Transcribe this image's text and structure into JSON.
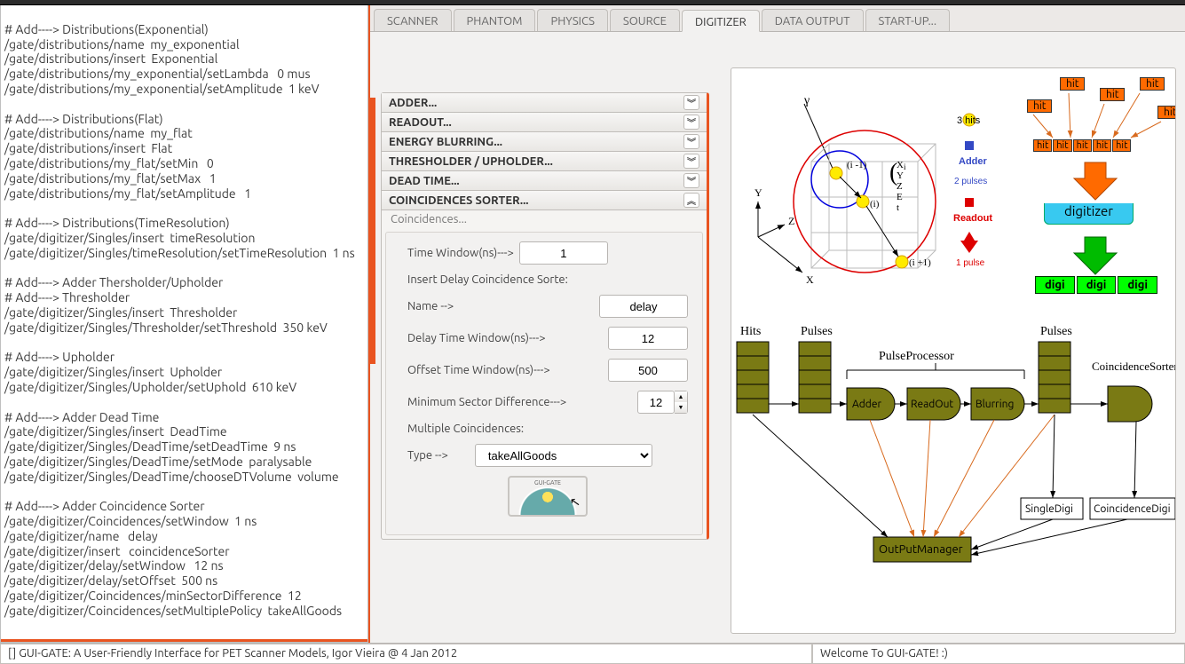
{
  "tabs": [
    "SCANNER",
    "PHANTOM",
    "PHYSICS",
    "SOURCE",
    "DIGITIZER",
    "DATA OUTPUT",
    "START-UP..."
  ],
  "active_tab": "DIGITIZER",
  "code_lines": [
    "",
    "# Add----> Distributions(Exponential)",
    "/gate/distributions/name  my_exponential",
    "/gate/distributions/insert  Exponential",
    "/gate/distributions/my_exponential/setLambda   0 mus",
    "/gate/distributions/my_exponential/setAmplitude  1 keV",
    "",
    "# Add----> Distributions(Flat)",
    "/gate/distributions/name  my_flat",
    "/gate/distributions/insert  Flat",
    "/gate/distributions/my_flat/setMin   0",
    "/gate/distributions/my_flat/setMax   1",
    "/gate/distributions/my_flat/setAmplitude   1",
    "",
    "# Add----> Distributions(TimeResolution)",
    "/gate/digitizer/Singles/insert  timeResolution",
    "/gate/digitizer/Singles/timeResolution/setTimeResolution  1 ns",
    "",
    "# Add----> Adder Thersholder/Upholder",
    "# Add----> Thresholder",
    "/gate/digitizer/Singles/insert  Thresholder",
    "/gate/digitizer/Singles/Thresholder/setThreshold  350 keV",
    "",
    "# Add----> Upholder",
    "/gate/digitizer/Singles/insert  Upholder",
    "/gate/digitizer/Singles/Upholder/setUphold  610 keV",
    "",
    "# Add----> Adder Dead Time",
    "/gate/digitizer/Singles/insert  DeadTime",
    "/gate/digitizer/Singles/DeadTime/setDeadTime  9 ns",
    "/gate/digitizer/Singles/DeadTime/setMode  paralysable",
    "/gate/digitizer/Singles/DeadTime/chooseDTVolume  volume",
    "",
    "# Add----> Adder Coincidence Sorter",
    "/gate/digitizer/Coincidences/setWindow  1 ns",
    "/gate/digitizer/name   delay",
    "/gate/digitizer/insert   coincidenceSorter",
    "/gate/digitizer/delay/setWindow   12 ns",
    "/gate/digitizer/delay/setOffset  500 ns",
    "/gate/digitizer/Coincidences/minSectorDifference  12",
    "/gate/digitizer/Coincidences/setMultiplePolicy  takeAllGoods"
  ],
  "accordion": {
    "sections": [
      {
        "label": "ADDER...",
        "open": false
      },
      {
        "label": "READOUT...",
        "open": false
      },
      {
        "label": "ENERGY BLURRING...",
        "open": false
      },
      {
        "label": "THRESHOLDER / UPHOLDER...",
        "open": false
      },
      {
        "label": "DEAD TIME...",
        "open": false
      },
      {
        "label": "COINCIDENCES SORTER...",
        "open": true
      }
    ],
    "coincidences": {
      "subtitle": "Coincidences...",
      "labels": {
        "time_window": "Time Window(ns)--->",
        "insert_delay": "Insert Delay Coincidence Sorte:",
        "name": "Name -->",
        "delay_window": "Delay Time Window(ns)--->",
        "offset_window": "Offset Time Window(ns)--->",
        "min_sector": "Minimum Sector Difference--->",
        "multiple": "Multiple Coincidences:",
        "type": "Type -->"
      },
      "values": {
        "time_window": "1",
        "name": "delay",
        "delay_window": "12",
        "offset_window": "500",
        "min_sector": "12",
        "type": "takeAllGoods"
      }
    }
  },
  "diagram": {
    "top": {
      "gamma": "γ",
      "labels_i": [
        "(i -1)",
        "(i)",
        "(i +1)"
      ],
      "coord_letters": [
        "X",
        "Y",
        "Z",
        "E",
        "t"
      ],
      "axis": {
        "x": "X",
        "y": "Y",
        "z": "Z"
      },
      "legend": {
        "hits3": "3 hits",
        "adder": "Adder",
        "pulses2": "2 pulses",
        "readout": "Readout",
        "pulse1": "1 pulse"
      },
      "hit_boxes_top": [
        "hit",
        "hit",
        "hit",
        "hit",
        "hit"
      ],
      "hit_row": [
        "hit",
        "hit",
        "hit",
        "hit",
        "hit"
      ],
      "digitizer": "digitizer",
      "digi_row": [
        "digi",
        "digi",
        "digi"
      ]
    },
    "bottom": {
      "hits": "Hits",
      "pulses": "Pulses",
      "pulses2": "Pulses",
      "pp": "PulseProcessor",
      "stages": [
        "Adder",
        "ReadOut",
        "Blurring"
      ],
      "cs": "CoincidenceSorter",
      "single": "SingleDigi",
      "coinc": "CoincidenceDigi",
      "out": "OutPutManager"
    }
  },
  "status": {
    "left": "[] GUI-GATE: A User-Friendly Interface for PET Scanner Models, Igor Vieira @ 4 Jan 2012",
    "right": "Welcome To GUI-GATE! :)"
  }
}
